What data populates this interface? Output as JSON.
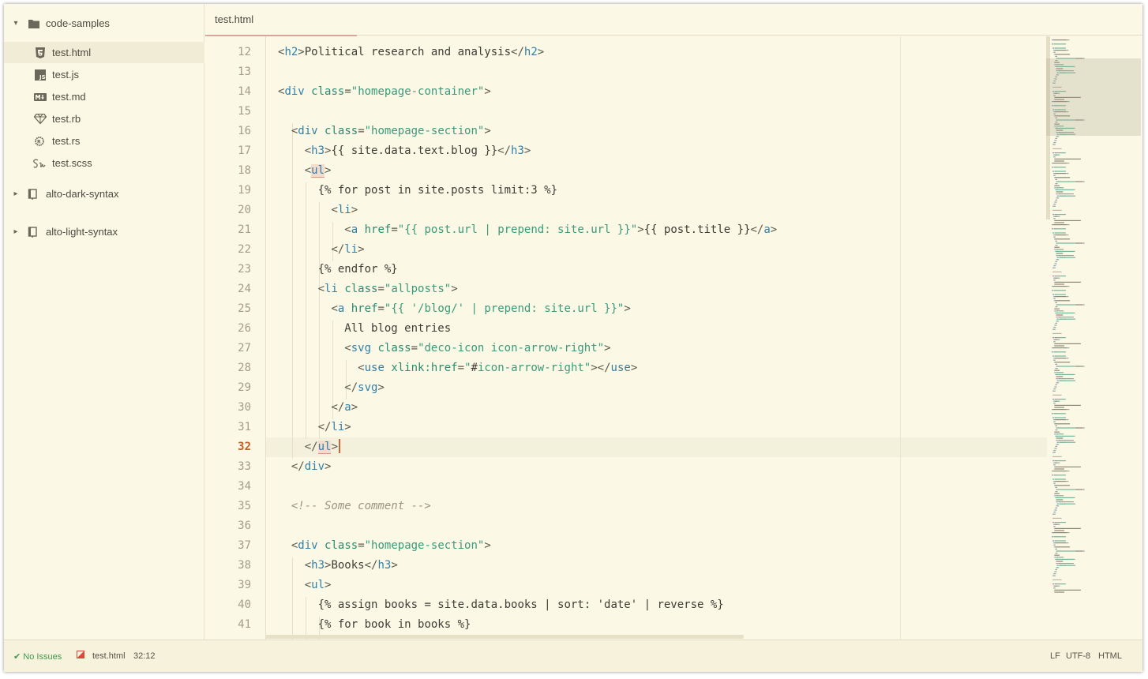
{
  "colors": {
    "background": "#fbf8e6",
    "tag": "#2f7fa8",
    "attribute": "#2b8a6f",
    "string": "#3a9a7a",
    "cursor": "#d0643b",
    "ok": "#3e9a4f"
  },
  "sidebar": {
    "root": {
      "label": "code-samples",
      "icon": "folder-icon",
      "expanded": true
    },
    "files": [
      {
        "label": "test.html",
        "icon": "html5-icon",
        "selected": true
      },
      {
        "label": "test.js",
        "icon": "js-icon"
      },
      {
        "label": "test.md",
        "icon": "markdown-icon"
      },
      {
        "label": "test.rb",
        "icon": "ruby-gem-icon"
      },
      {
        "label": "test.rs",
        "icon": "rust-icon"
      },
      {
        "label": "test.scss",
        "icon": "sass-icon"
      }
    ],
    "folders": [
      {
        "label": "alto-dark-syntax",
        "icon": "repo-icon",
        "expanded": false
      },
      {
        "label": "alto-light-syntax",
        "icon": "repo-icon",
        "expanded": false
      }
    ]
  },
  "tabs": [
    {
      "label": "test.html",
      "active": true
    }
  ],
  "editor": {
    "current_line": 32,
    "lines": [
      {
        "n": 12,
        "tokens": [
          [
            "p",
            "<"
          ],
          [
            "tag",
            "h2"
          ],
          [
            "p",
            ">"
          ],
          [
            "",
            "Political research and analysis"
          ],
          [
            "p",
            "</"
          ],
          [
            "tag",
            "h2"
          ],
          [
            "p",
            ">"
          ]
        ]
      },
      {
        "n": 13,
        "tokens": []
      },
      {
        "n": 14,
        "tokens": [
          [
            "p",
            "<"
          ],
          [
            "tag",
            "div"
          ],
          [
            "",
            " "
          ],
          [
            "attr",
            "class"
          ],
          [
            "p",
            "="
          ],
          [
            "str",
            "\"homepage-container\""
          ],
          [
            "p",
            ">"
          ]
        ]
      },
      {
        "n": 15,
        "tokens": []
      },
      {
        "n": 16,
        "tokens": [
          [
            "",
            "  "
          ],
          [
            "p",
            "<"
          ],
          [
            "tag",
            "div"
          ],
          [
            "",
            " "
          ],
          [
            "attr",
            "class"
          ],
          [
            "p",
            "="
          ],
          [
            "str",
            "\"homepage-section\""
          ],
          [
            "p",
            ">"
          ]
        ]
      },
      {
        "n": 17,
        "tokens": [
          [
            "",
            "    "
          ],
          [
            "p",
            "<"
          ],
          [
            "tag",
            "h3"
          ],
          [
            "p",
            ">"
          ],
          [
            "",
            "{{ site.data.text.blog }}"
          ],
          [
            "p",
            "</"
          ],
          [
            "tag",
            "h3"
          ],
          [
            "p",
            ">"
          ]
        ]
      },
      {
        "n": 18,
        "tokens": [
          [
            "",
            "    "
          ],
          [
            "p",
            "<"
          ],
          [
            "tag hl",
            "ul"
          ],
          [
            "p",
            ">"
          ]
        ]
      },
      {
        "n": 19,
        "tokens": [
          [
            "",
            "      "
          ],
          [
            "",
            "{% for post in site.posts limit:3 %}"
          ]
        ]
      },
      {
        "n": 20,
        "tokens": [
          [
            "",
            "        "
          ],
          [
            "p",
            "<"
          ],
          [
            "tag",
            "li"
          ],
          [
            "p",
            ">"
          ]
        ]
      },
      {
        "n": 21,
        "tokens": [
          [
            "",
            "          "
          ],
          [
            "p",
            "<"
          ],
          [
            "tag",
            "a"
          ],
          [
            "",
            " "
          ],
          [
            "attr",
            "href"
          ],
          [
            "p",
            "="
          ],
          [
            "str",
            "\"{{ post.url | prepend: site.url }}\""
          ],
          [
            "p",
            ">"
          ],
          [
            "",
            "{{ post.title }}"
          ],
          [
            "p",
            "</"
          ],
          [
            "tag",
            "a"
          ],
          [
            "p",
            ">"
          ]
        ]
      },
      {
        "n": 22,
        "tokens": [
          [
            "",
            "        "
          ],
          [
            "p",
            "</"
          ],
          [
            "tag",
            "li"
          ],
          [
            "p",
            ">"
          ]
        ]
      },
      {
        "n": 23,
        "tokens": [
          [
            "",
            "      "
          ],
          [
            "",
            "{% endfor %}"
          ]
        ]
      },
      {
        "n": 24,
        "tokens": [
          [
            "",
            "      "
          ],
          [
            "p",
            "<"
          ],
          [
            "tag",
            "li"
          ],
          [
            "",
            " "
          ],
          [
            "attr",
            "class"
          ],
          [
            "p",
            "="
          ],
          [
            "str",
            "\"allposts\""
          ],
          [
            "p",
            ">"
          ]
        ]
      },
      {
        "n": 25,
        "tokens": [
          [
            "",
            "        "
          ],
          [
            "p",
            "<"
          ],
          [
            "tag",
            "a"
          ],
          [
            "",
            " "
          ],
          [
            "attr",
            "href"
          ],
          [
            "p",
            "="
          ],
          [
            "str",
            "\"{{ '/blog/' | prepend: site.url }}\""
          ],
          [
            "p",
            ">"
          ]
        ]
      },
      {
        "n": 26,
        "tokens": [
          [
            "",
            "          "
          ],
          [
            "",
            "All blog entries"
          ]
        ]
      },
      {
        "n": 27,
        "tokens": [
          [
            "",
            "          "
          ],
          [
            "p",
            "<"
          ],
          [
            "tag",
            "svg"
          ],
          [
            "",
            " "
          ],
          [
            "attr",
            "class"
          ],
          [
            "p",
            "="
          ],
          [
            "str",
            "\"deco-icon icon-arrow-right\""
          ],
          [
            "p",
            ">"
          ]
        ]
      },
      {
        "n": 28,
        "tokens": [
          [
            "",
            "            "
          ],
          [
            "p",
            "<"
          ],
          [
            "tag",
            "use"
          ],
          [
            "",
            " "
          ],
          [
            "attr",
            "xlink:href"
          ],
          [
            "p",
            "="
          ],
          [
            "str",
            "\""
          ],
          [
            "",
            "#"
          ],
          [
            "str",
            "icon-arrow-right\""
          ],
          [
            "p",
            "></"
          ],
          [
            "tag",
            "use"
          ],
          [
            "p",
            ">"
          ]
        ]
      },
      {
        "n": 29,
        "tokens": [
          [
            "",
            "          "
          ],
          [
            "p",
            "</"
          ],
          [
            "tag",
            "svg"
          ],
          [
            "p",
            ">"
          ]
        ]
      },
      {
        "n": 30,
        "tokens": [
          [
            "",
            "        "
          ],
          [
            "p",
            "</"
          ],
          [
            "tag",
            "a"
          ],
          [
            "p",
            ">"
          ]
        ]
      },
      {
        "n": 31,
        "tokens": [
          [
            "",
            "      "
          ],
          [
            "p",
            "</"
          ],
          [
            "tag",
            "li"
          ],
          [
            "p",
            ">"
          ]
        ]
      },
      {
        "n": 32,
        "tokens": [
          [
            "",
            "    "
          ],
          [
            "p",
            "</"
          ],
          [
            "tag hl",
            "ul"
          ],
          [
            "p",
            ">"
          ],
          [
            "cursor",
            ""
          ]
        ]
      },
      {
        "n": 33,
        "tokens": [
          [
            "",
            "  "
          ],
          [
            "p",
            "</"
          ],
          [
            "tag",
            "div"
          ],
          [
            "p",
            ">"
          ]
        ]
      },
      {
        "n": 34,
        "tokens": []
      },
      {
        "n": 35,
        "tokens": [
          [
            "",
            "  "
          ],
          [
            "cmt",
            "<!-- Some comment -->"
          ]
        ]
      },
      {
        "n": 36,
        "tokens": []
      },
      {
        "n": 37,
        "tokens": [
          [
            "",
            "  "
          ],
          [
            "p",
            "<"
          ],
          [
            "tag",
            "div"
          ],
          [
            "",
            " "
          ],
          [
            "attr",
            "class"
          ],
          [
            "p",
            "="
          ],
          [
            "str",
            "\"homepage-section\""
          ],
          [
            "p",
            ">"
          ]
        ]
      },
      {
        "n": 38,
        "tokens": [
          [
            "",
            "    "
          ],
          [
            "p",
            "<"
          ],
          [
            "tag",
            "h3"
          ],
          [
            "p",
            ">"
          ],
          [
            "",
            "Books"
          ],
          [
            "p",
            "</"
          ],
          [
            "tag",
            "h3"
          ],
          [
            "p",
            ">"
          ]
        ]
      },
      {
        "n": 39,
        "tokens": [
          [
            "",
            "    "
          ],
          [
            "p",
            "<"
          ],
          [
            "tag",
            "ul"
          ],
          [
            "p",
            ">"
          ]
        ]
      },
      {
        "n": 40,
        "tokens": [
          [
            "",
            "      "
          ],
          [
            "",
            "{% assign books = site.data.books | sort: 'date' | reverse %}"
          ]
        ]
      },
      {
        "n": 41,
        "tokens": [
          [
            "",
            "      "
          ],
          [
            "",
            "{% for book in books %}"
          ]
        ]
      }
    ]
  },
  "statusbar": {
    "issues": "No Issues",
    "file": "test.html",
    "position": "32:12",
    "line_ending": "LF",
    "encoding": "UTF-8",
    "grammar": "HTML"
  }
}
